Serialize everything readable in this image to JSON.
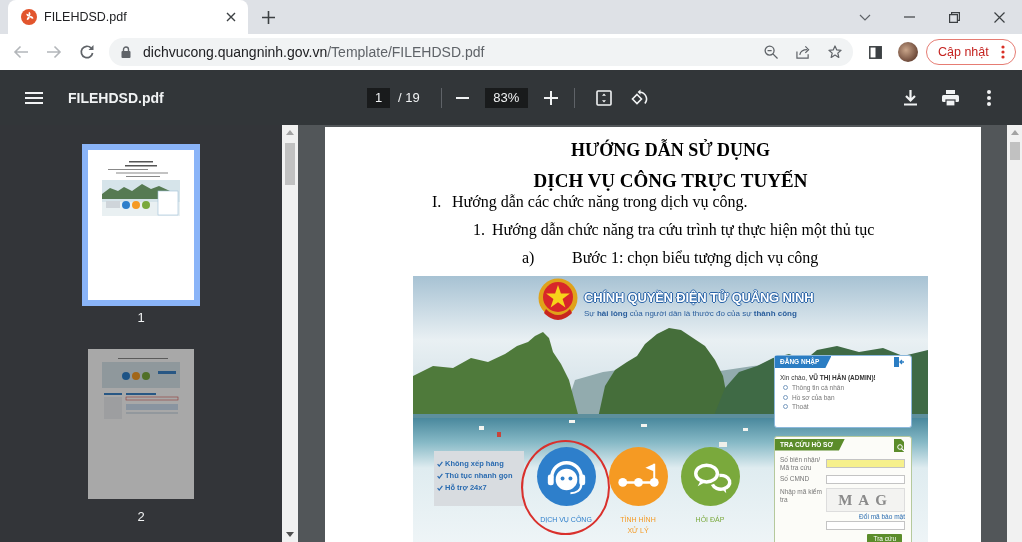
{
  "browser": {
    "tabs": [
      {
        "title": "FILEHDSD.pdf",
        "selected": true
      }
    ],
    "nav": [
      {
        "kind": "back",
        "disabled": true
      },
      {
        "kind": "forward",
        "disabled": true
      },
      {
        "kind": "reload",
        "disabled": false
      }
    ],
    "address": {
      "host": "dichvucong.quangninh.gov.vn",
      "path": "/Template/FILEHDSD.pdf"
    },
    "update_button": "Cập nhật"
  },
  "pdf_toolbar": {
    "file_name": "FILEHDSD.pdf",
    "page": "1",
    "page_total": "/ 19",
    "zoom": "83%"
  },
  "thumbnails": [
    {
      "label": "1",
      "selected": true
    },
    {
      "label": "2",
      "selected": false
    }
  ],
  "document": {
    "title_lines": [
      "HƯỚNG DẪN SỬ DỤNG",
      "DỊCH VỤ CÔNG TRỰC TUYẾN"
    ],
    "outline": [
      {
        "marker": "I.",
        "text": "Hướng dẫn các chức năng trong dịch vụ công.",
        "children": [
          {
            "marker": "1.",
            "text": "Hướng dẫn chức năng tra cứu trình tự thực hiện một thủ tục",
            "children": [
              {
                "marker": "a)",
                "text": "Bước 1: chọn biểu tượng dịch vụ công"
              }
            ]
          }
        ]
      }
    ],
    "screenshot": {
      "site_title": "CHÍNH QUYỀN ĐIỆN TỬ QUẢNG NINH",
      "slogan": "Sự **hài lòng** của người dân là thước đo của sự **thành công**",
      "login": {
        "heading": "ĐĂNG NHẬP",
        "greeting": "Xin chào, **VŨ THỊ HÂN (ADMIN)!**",
        "links": [
          "Thông tin cá nhân",
          "Hồ sơ của bạn",
          "Thoát"
        ]
      },
      "lookup": {
        "heading": "TRA CỨU HỒ SƠ",
        "fields": [
          {
            "kind": "input",
            "label": "Số biên nhận/ Mã tra cứu",
            "highlighted": true
          },
          {
            "kind": "input",
            "label": "Số CMND",
            "highlighted": false
          },
          {
            "kind": "captcha",
            "label": "Nhập mã kiểm tra",
            "captcha": "MAG",
            "refresh_link": "Đổi mã bảo mật",
            "highlighted": false
          }
        ],
        "button": "Tra cứu"
      },
      "benefits": [
        "Không xếp hàng",
        "Thủ tục nhanh gọn",
        "Hỗ trợ 24x7"
      ],
      "services": [
        {
          "kind": "headset",
          "label": "DỊCH VỤ CÔNG",
          "color": "#2e7fcb",
          "circled": true
        },
        {
          "kind": "route",
          "label": "TÌNH HÌNH XỬ LÝ",
          "color": "#f59a23",
          "circled": false
        },
        {
          "kind": "chat",
          "label": "HỎI ĐÁP",
          "color": "#7aa93c",
          "circled": false
        }
      ]
    }
  }
}
